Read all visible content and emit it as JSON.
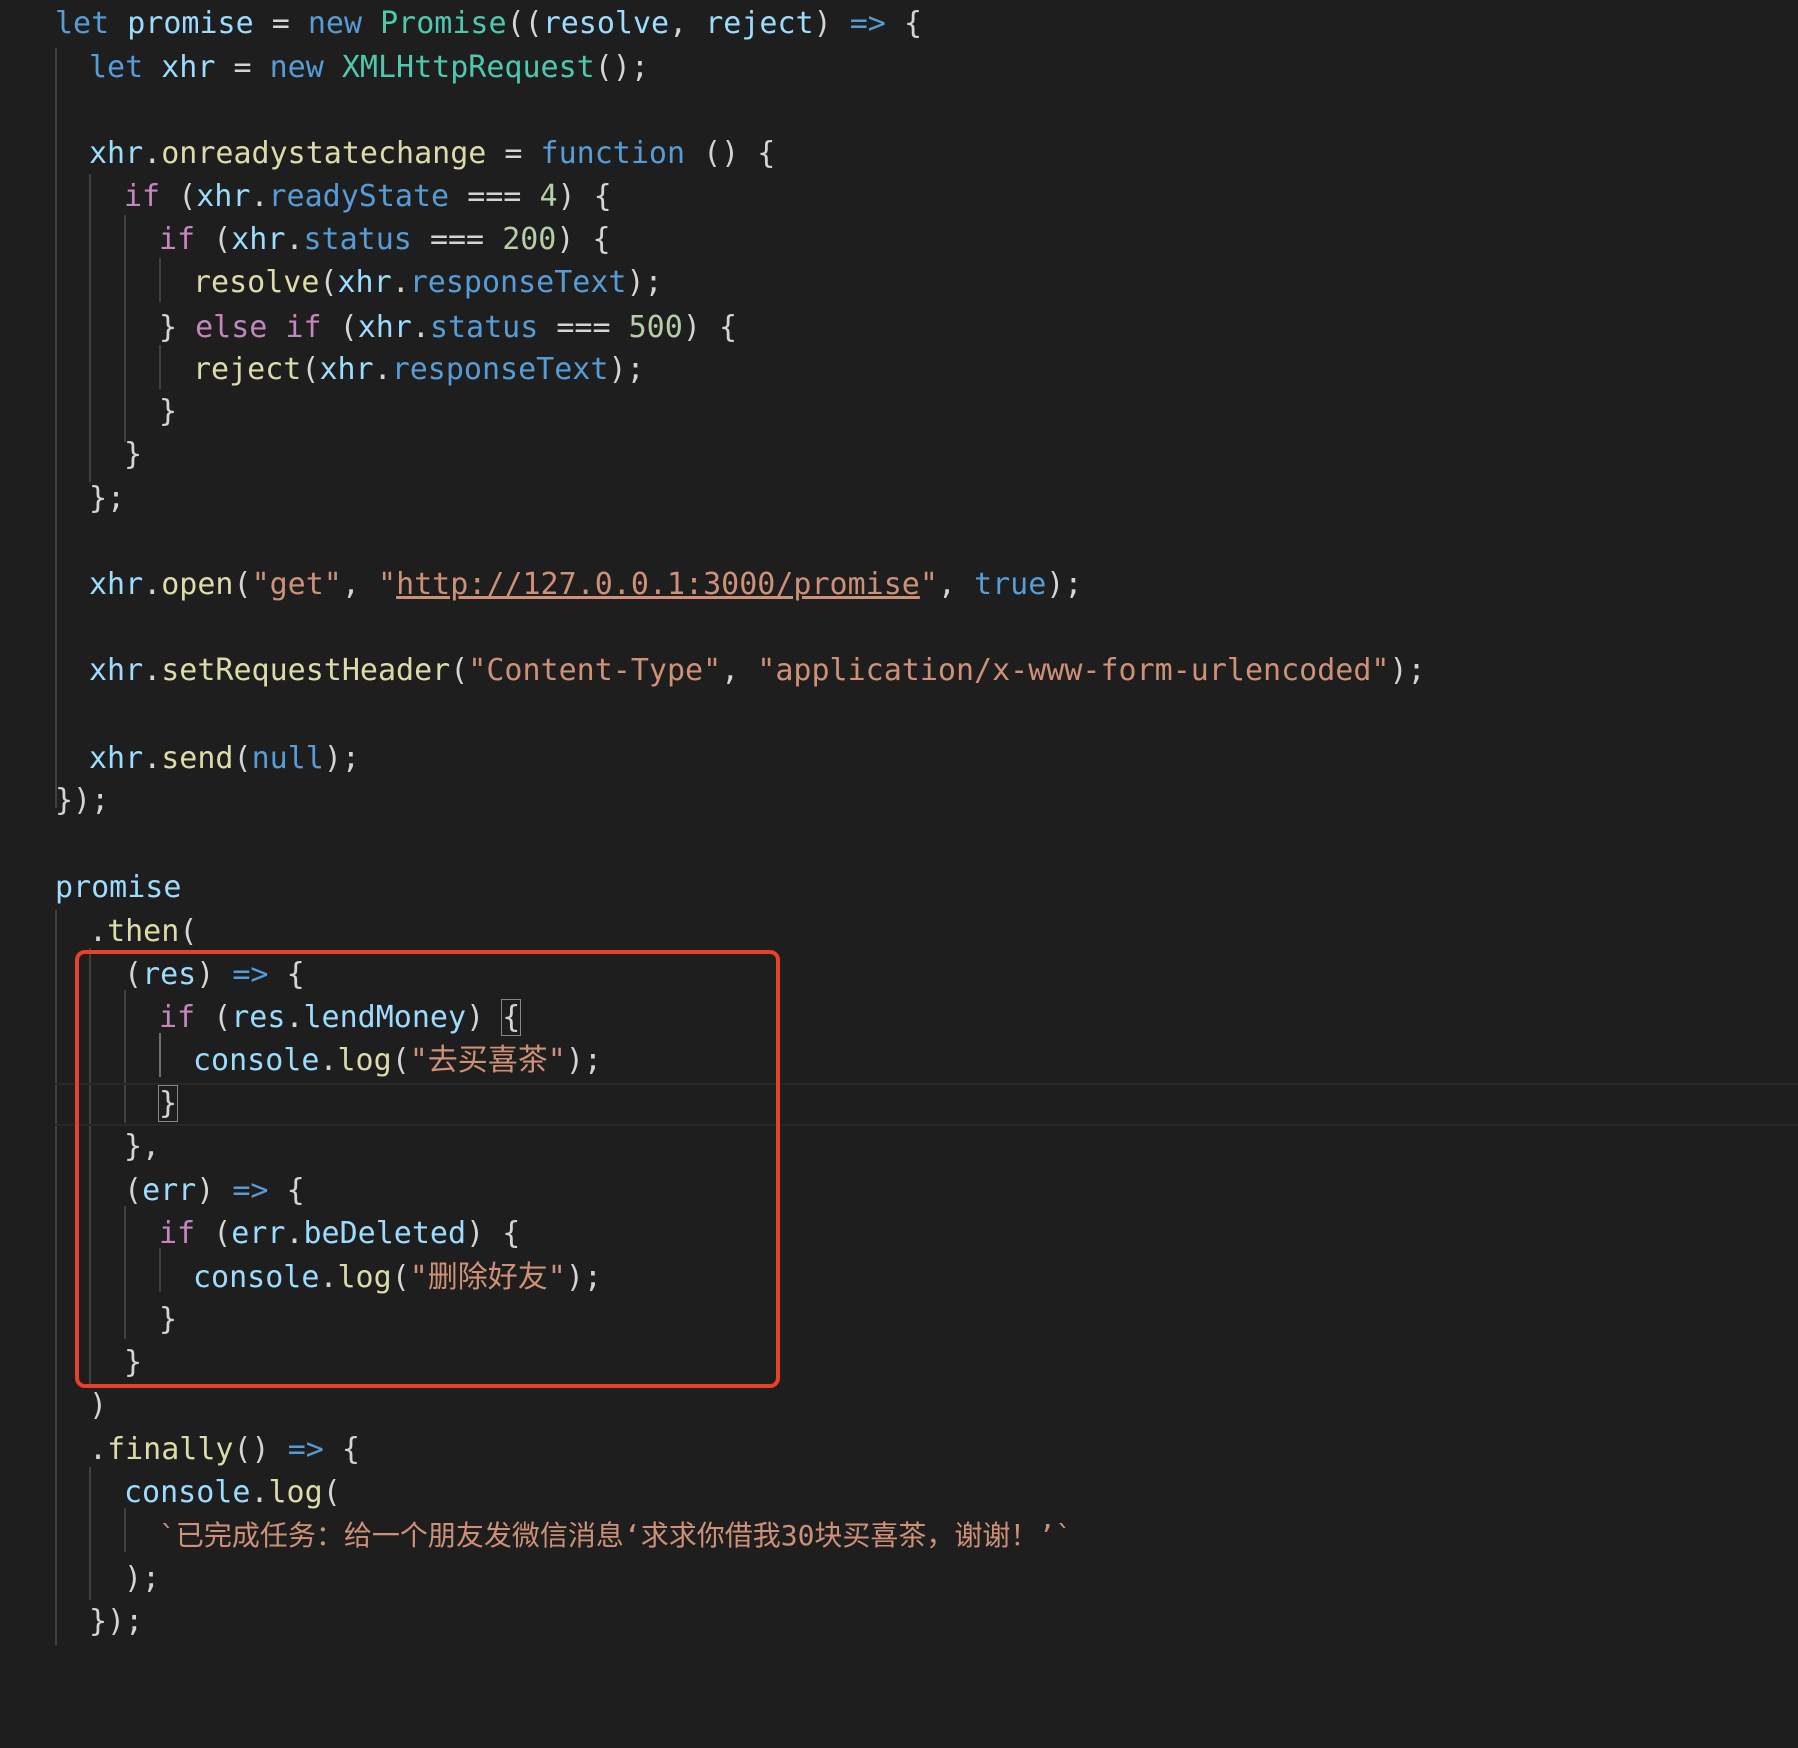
{
  "editor": {
    "language": "javascript",
    "theme": "dark",
    "highlighted_region": "then-callbacks",
    "colors": {
      "background": "#1e1e1e",
      "keyword": "#569cd6",
      "control": "#c586c0",
      "variable": "#9cdcfe",
      "function": "#dcdcaa",
      "class": "#4ec9b0",
      "string": "#ce9178",
      "number": "#b5cea8",
      "highlight_box": "#e8402a"
    }
  },
  "tokens": {
    "let": "let",
    "promise": "promise",
    "eq": "=",
    "new": "new",
    "Promise": "Promise",
    "paren_open_open": "((",
    "resolve": "resolve",
    "comma": ",",
    "reject": "reject",
    "paren_close": ")",
    "arrow": "=>",
    "brace_open": "{",
    "xhr": "xhr",
    "XMLHttpRequest": "XMLHttpRequest",
    "call_end_semi": "();",
    "dot": ".",
    "onreadystatechange": "onreadystatechange",
    "function": "function",
    "empty_parens": "()",
    "if": "if",
    "paren_open": "(",
    "readyState": "readyState",
    "strict_eq": "===",
    "n4": "4",
    "status": "status",
    "n200": "200",
    "responseText": "responseText",
    "paren_close_semi": ");",
    "brace_close": "}",
    "else": "else",
    "n500": "500",
    "brace_close_semi": "};",
    "open": "open",
    "str_get": "\"get\"",
    "quote": "\"",
    "url": "http://127.0.0.1:3000/promise",
    "true": "true",
    "setRequestHeader": "setRequestHeader",
    "str_content_type": "\"Content-Type\"",
    "str_form": "\"application/x-www-form-urlencoded\"",
    "send": "send",
    "null": "null",
    "brace_paren_semi": "});",
    "then": "then",
    "res": "res",
    "lendMoney": "lendMoney",
    "console": "console",
    "log": "log",
    "str_buy_tea": "\"去买喜茶\"",
    "brace_close_comma": "},",
    "err": "err",
    "beDeleted": "beDeleted",
    "str_delete_friend": "\"删除好友\"",
    "finally": "finally",
    "template_string": "`已完成任务：给一个朋友发微信消息‘求求你借我30块买喜茶，谢谢！’`"
  }
}
